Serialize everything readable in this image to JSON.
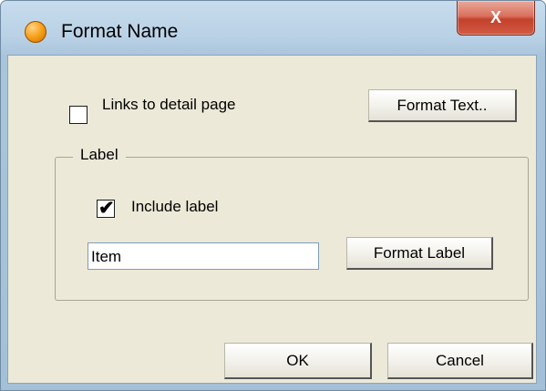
{
  "window": {
    "title": "Format Name",
    "close_glyph": "X"
  },
  "links_checkbox": {
    "label": "Links to detail page",
    "checked": false
  },
  "format_text_button": "Format Text..",
  "label_group": {
    "title": "Label",
    "include_checkbox": {
      "label": "Include label",
      "checked": true
    },
    "label_input_value": "Item",
    "format_label_button": "Format Label"
  },
  "footer": {
    "ok_label": "OK",
    "cancel_label": "Cancel"
  }
}
